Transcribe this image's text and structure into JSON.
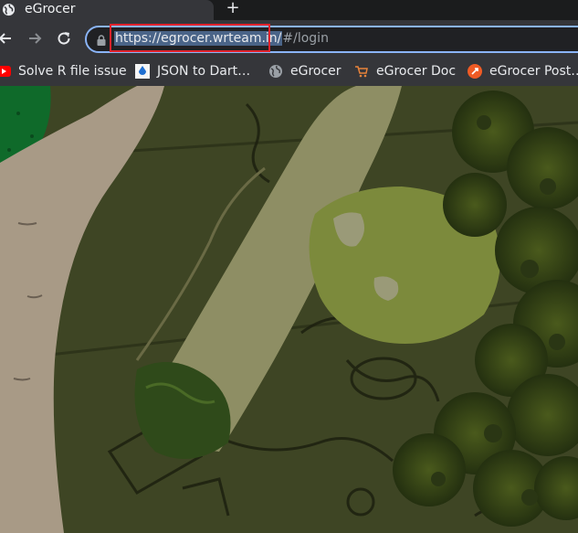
{
  "tab": {
    "title": "eGrocer",
    "new_tab_symbol": "+",
    "favicon": "globe-icon"
  },
  "omnibox": {
    "url_selected": "https://egrocer.wrteam.in/",
    "url_rest": "#/login"
  },
  "bookmarks": [
    {
      "label": "Solve R file issue",
      "icon": "youtube-icon"
    },
    {
      "label": "JSON to Dart…",
      "icon": "json-icon"
    },
    {
      "label": "eGrocer",
      "icon": "globe-icon"
    },
    {
      "label": "eGrocer Doc",
      "icon": "cart-icon"
    },
    {
      "label": "eGrocer Post…",
      "icon": "postman-icon"
    }
  ],
  "colors": {
    "highlight_border": "#e1232c",
    "omnibox_focus": "#8ab4f8",
    "selection": "#4a6488"
  }
}
